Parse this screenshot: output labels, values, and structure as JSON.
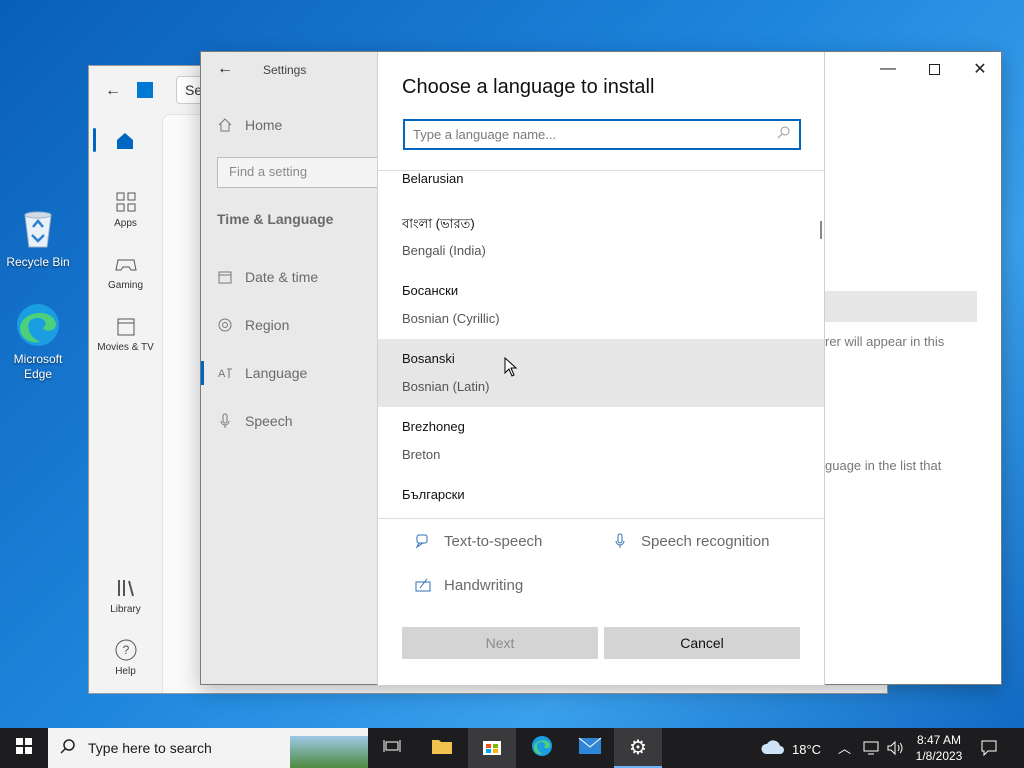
{
  "desktop": {
    "icons": [
      {
        "label": "Recycle Bin"
      },
      {
        "label": "Microsoft\nEdge"
      }
    ]
  },
  "store": {
    "search_partial": "Se",
    "rail": [
      {
        "label": "Apps"
      },
      {
        "label": "Gaming"
      },
      {
        "label": "Movies & TV"
      },
      {
        "label": "Library"
      },
      {
        "label": "Help"
      }
    ]
  },
  "settings": {
    "title": "Settings",
    "nav": {
      "home": "Home",
      "search_placeholder": "Find a setting",
      "section": "Time & Language",
      "items": [
        {
          "label": "Date & time"
        },
        {
          "label": "Region"
        },
        {
          "label": "Language"
        },
        {
          "label": "Speech"
        }
      ]
    },
    "peek_text_1": "rer will appear in this",
    "peek_text_2": "guage in the list that"
  },
  "dialog": {
    "title": "Choose a language to install",
    "search_placeholder": "Type a language name...",
    "languages": [
      {
        "native": "Belarusian",
        "english": ""
      },
      {
        "native": "বাংলা (ভারত)",
        "english": "Bengali (India)"
      },
      {
        "native": "Босански",
        "english": "Bosnian (Cyrillic)"
      },
      {
        "native": "Bosanski",
        "english": "Bosnian (Latin)"
      },
      {
        "native": "Brezhoneg",
        "english": "Breton"
      },
      {
        "native": "Български",
        "english": ""
      }
    ],
    "features": {
      "tts": "Text-to-speech",
      "speech": "Speech recognition",
      "handwriting": "Handwriting"
    },
    "next_label": "Next",
    "cancel_label": "Cancel"
  },
  "taskbar": {
    "search_placeholder": "Type here to search",
    "weather": "18°C",
    "time": "8:47 AM",
    "date": "1/8/2023"
  },
  "colors": {
    "accent": "#0067c0",
    "taskbar": "#1d1d1f"
  }
}
